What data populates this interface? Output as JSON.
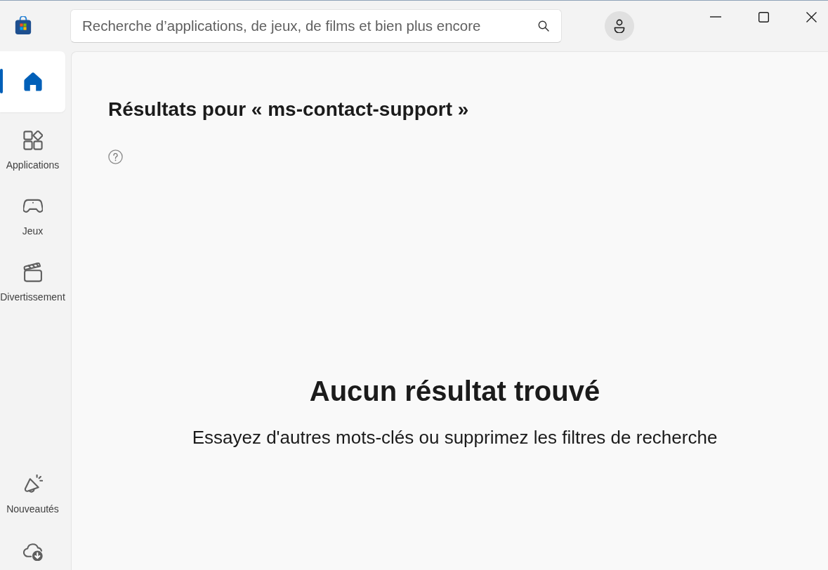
{
  "search": {
    "placeholder": "Recherche d’applications, de jeux, de films et bien plus encore"
  },
  "sidebar": {
    "items": [
      {
        "selected": true
      },
      {
        "label": "Applications",
        "selected": false
      },
      {
        "label": "Jeux",
        "selected": false
      },
      {
        "label": "Divertissement",
        "selected": false
      }
    ],
    "bottom_items": [
      {
        "label": "Nouveautés",
        "selected": false
      },
      {
        "selected": false
      }
    ]
  },
  "main": {
    "heading": "Résultats pour « ms-contact-support »",
    "empty_state": {
      "title": "Aucun résultat trouvé",
      "message": "Essayez d'autres mots-clés ou supprimez les filtres de recherche"
    }
  }
}
